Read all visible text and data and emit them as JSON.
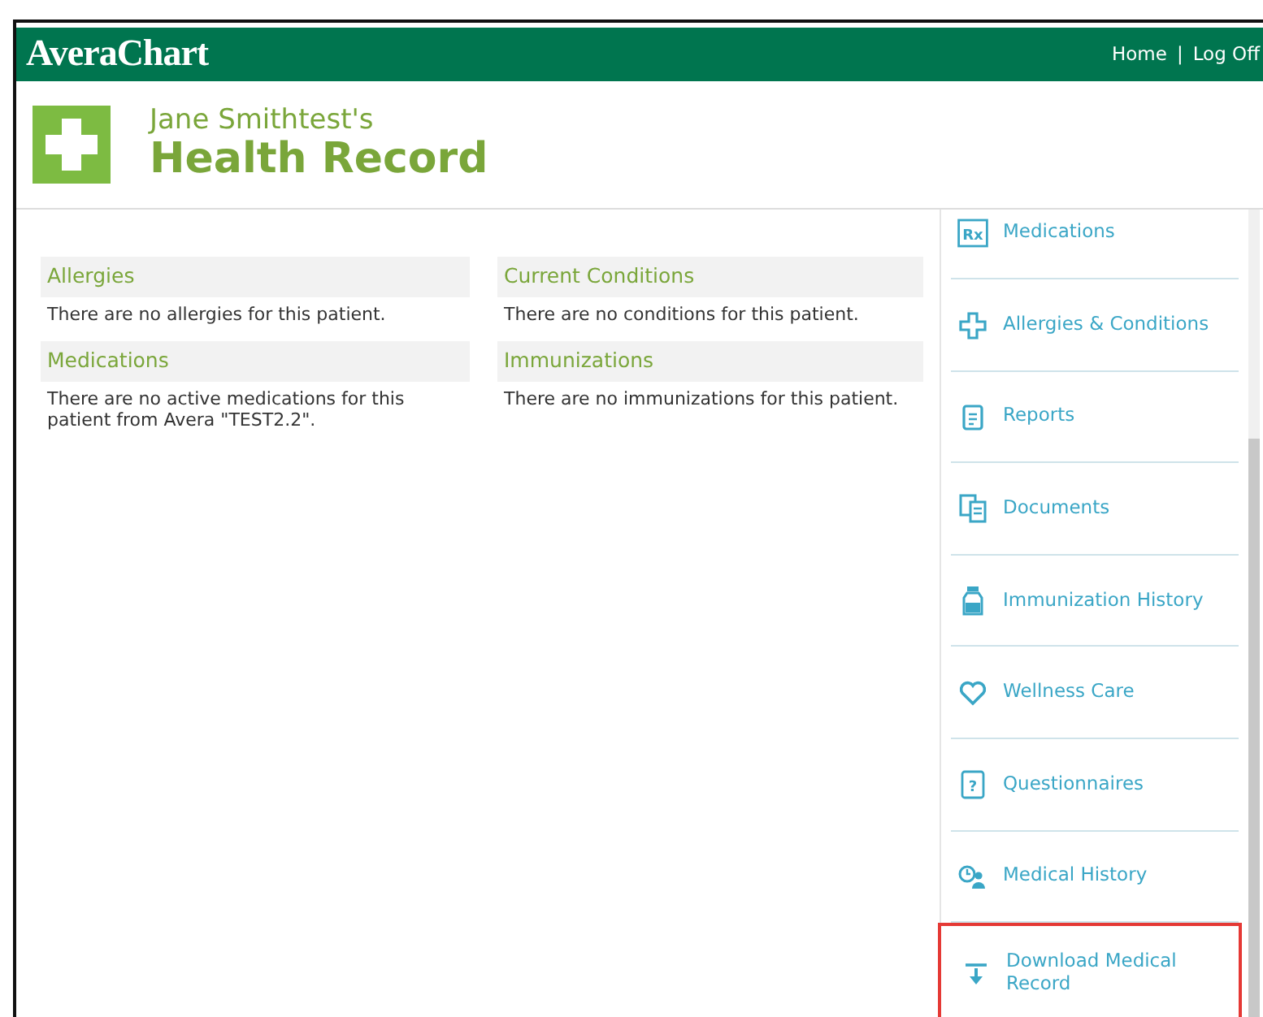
{
  "header": {
    "logo": "AveraChart",
    "links": [
      "Home",
      "Log Off"
    ],
    "separator": "|"
  },
  "title": {
    "owner": "Jane Smithtest's",
    "heading": "Health Record"
  },
  "sections": [
    {
      "heading": "Allergies",
      "text": "There are no allergies for this patient."
    },
    {
      "heading": "Current Conditions",
      "text": "There are no conditions for this patient."
    },
    {
      "heading": "Medications",
      "text": "There are no active medications for this patient from Avera \"TEST2.2\"."
    },
    {
      "heading": "Immunizations",
      "text": "There are no immunizations for this patient."
    }
  ],
  "sidebar": {
    "items": [
      {
        "label": "Medications",
        "kind": "rx",
        "icon_text": "Rx",
        "highlighted": false
      },
      {
        "label": "Allergies & Conditions",
        "kind": "cross",
        "highlighted": false
      },
      {
        "label": "Reports",
        "kind": "clipboard",
        "highlighted": false
      },
      {
        "label": "Documents",
        "kind": "documents",
        "highlighted": false
      },
      {
        "label": "Immunization History",
        "kind": "vial",
        "highlighted": false
      },
      {
        "label": "Wellness Care",
        "kind": "heart",
        "highlighted": false
      },
      {
        "label": "Questionnaires",
        "kind": "question",
        "icon_text": "?",
        "highlighted": false
      },
      {
        "label": "Medical History",
        "kind": "history",
        "highlighted": false
      },
      {
        "label": "Download Medical Record",
        "kind": "download",
        "highlighted": true
      }
    ]
  }
}
